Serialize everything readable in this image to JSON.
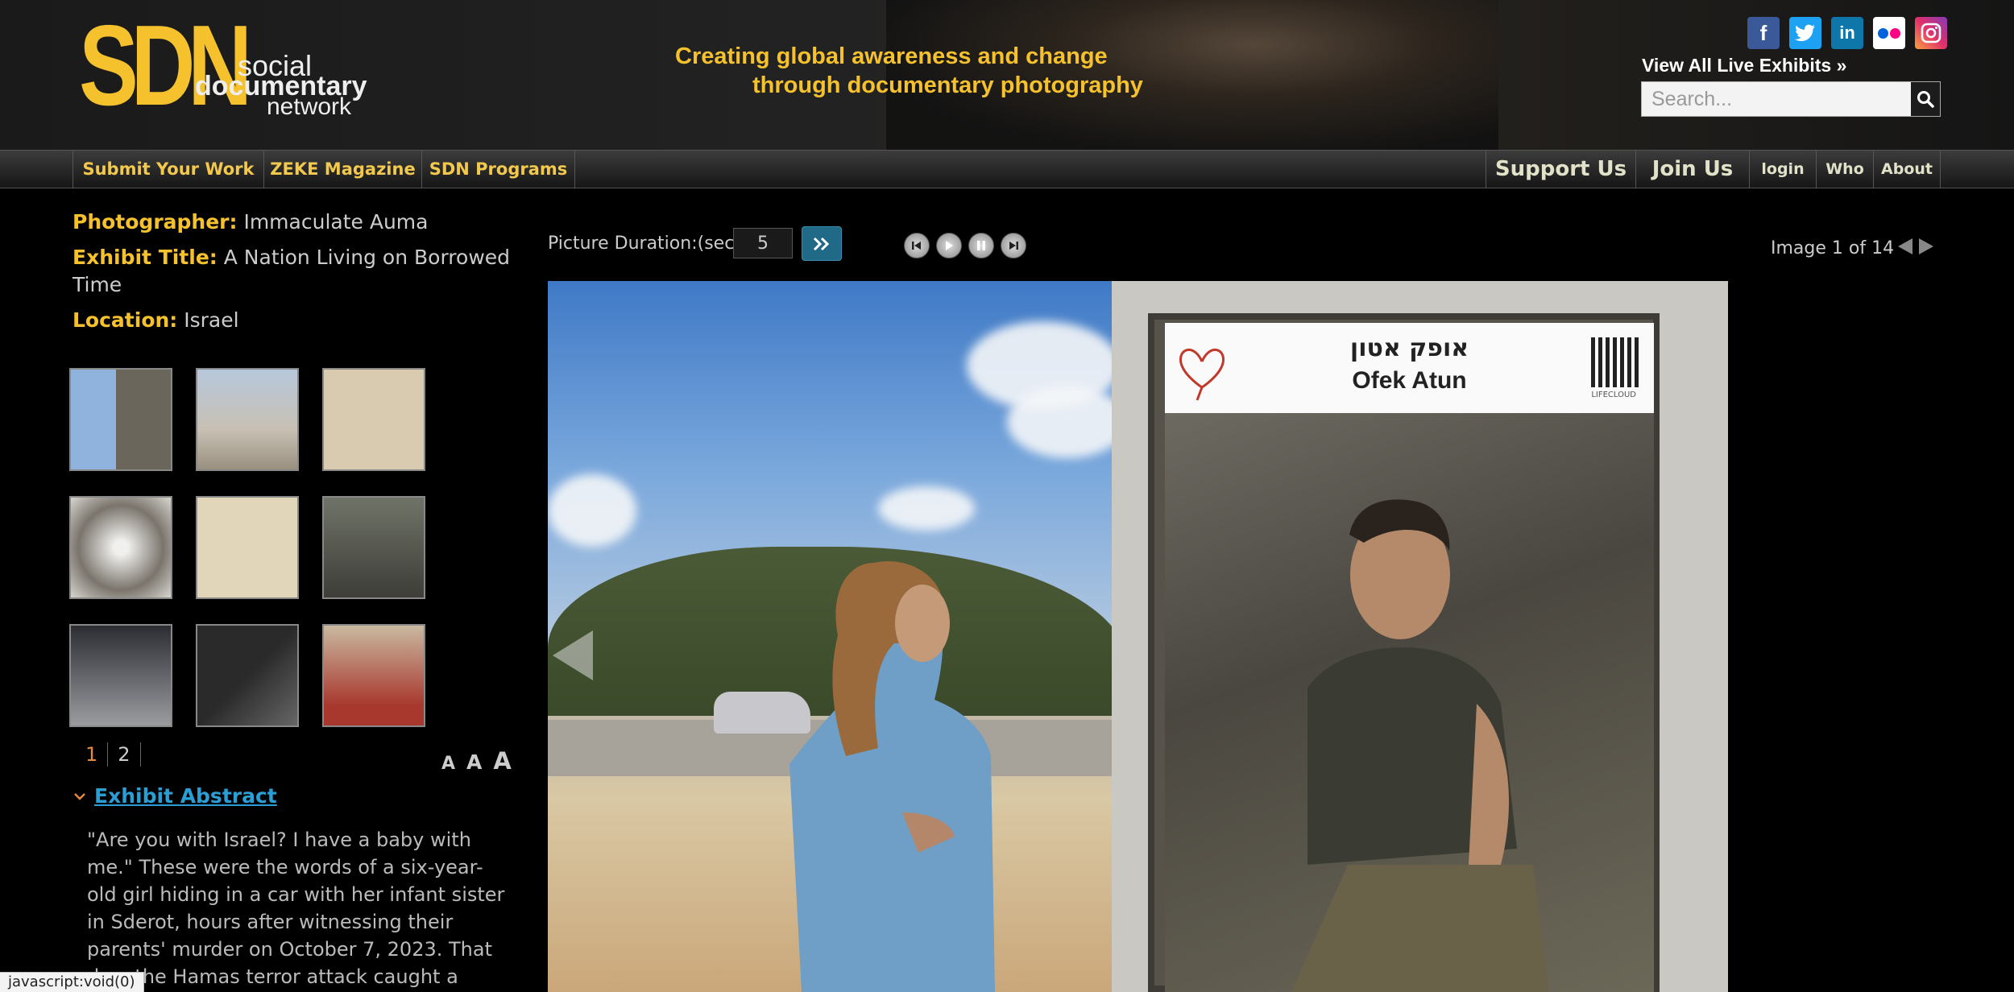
{
  "header": {
    "logo_big": "SDN",
    "logo_line1": "social",
    "logo_line2": "documentary",
    "logo_line3": "network",
    "tagline_line1": "Creating global awareness and change",
    "tagline_line2": "through documentary photography",
    "social_icons": [
      "facebook-icon",
      "twitter-icon",
      "linkedin-icon",
      "flickr-icon",
      "instagram-icon"
    ],
    "view_all": "View All Live Exhibits »",
    "search_placeholder": "Search..."
  },
  "nav": {
    "left": [
      "Submit Your Work",
      "ZEKE Magazine",
      "SDN Programs"
    ],
    "right": [
      "Support Us",
      "Join Us",
      "login",
      "Who",
      "About"
    ]
  },
  "exhibit": {
    "photographer_label": "Photographer:",
    "photographer": "Immaculate Auma",
    "title_label": "Exhibit Title:",
    "title": "A Nation Living on Borrowed Time",
    "location_label": "Location:",
    "location": "Israel"
  },
  "pager": {
    "pages": [
      "1",
      "2"
    ],
    "active": "1"
  },
  "font_sizes": [
    "A",
    "A",
    "A"
  ],
  "abstract": {
    "heading": "Exhibit Abstract",
    "text": "\"Are you with Israel? I have a baby with me.\" These were the words of a six-year-old girl hiding in a car with her infant sister in Sderot, hours after witnessing their parents' murder on October 7, 2023. That day, the Hamas terror attack caught a"
  },
  "controls": {
    "duration_label": "Picture Duration:(sec)",
    "duration_value": "5",
    "image_counter": "Image 1 of 14"
  },
  "photo": {
    "sign_hebrew": "אופק אטון",
    "sign_name": "Ofek Atun",
    "qr_caption": "LIFECLOUD"
  },
  "status_bar": "javascript:void(0)",
  "colors": {
    "accent": "#f5c12c",
    "link": "#2a9fd6",
    "active_page": "#e88a3a"
  }
}
